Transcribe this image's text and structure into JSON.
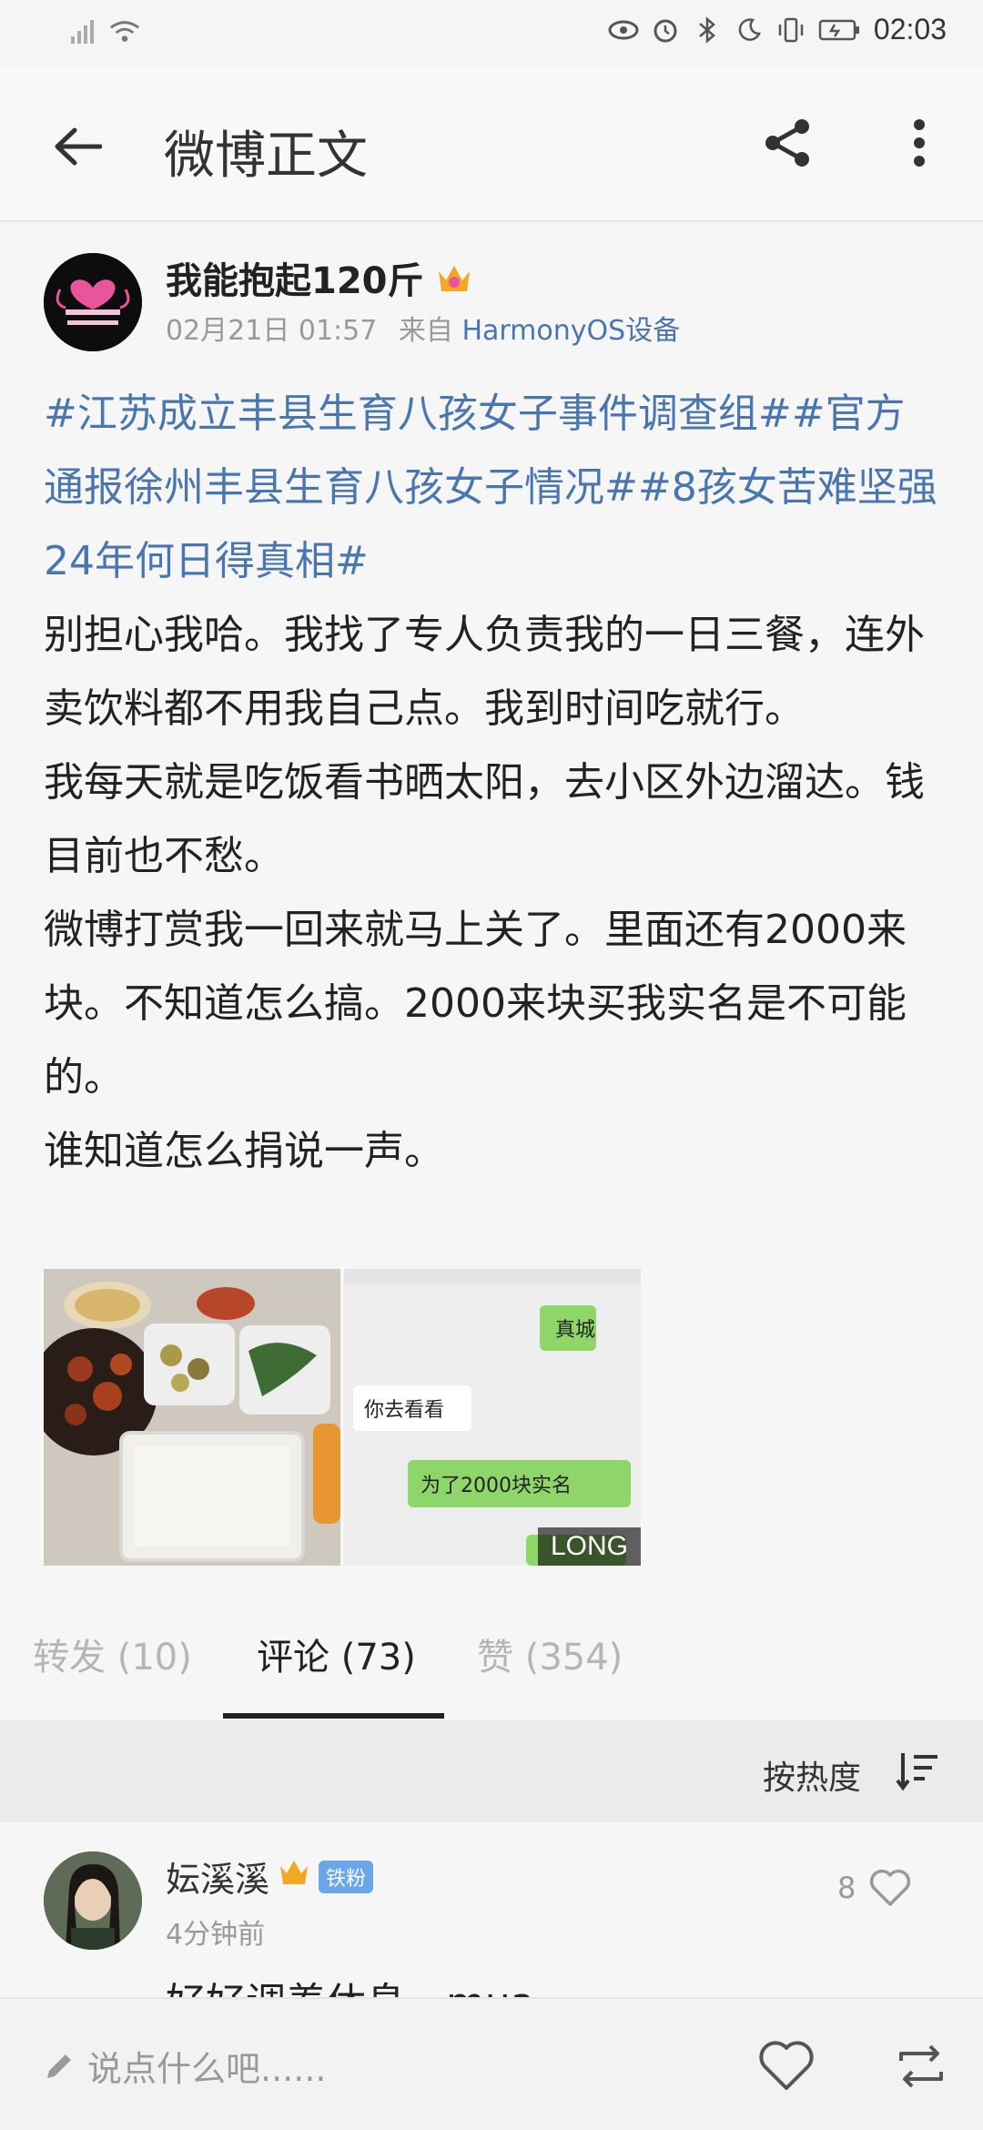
{
  "status_bar": {
    "time": "02:03"
  },
  "header": {
    "title": "微博正文"
  },
  "post": {
    "author": "我能抱起120斤",
    "timestamp": "02月21日 01:57",
    "source_prefix": "来自",
    "source": "HarmonyOS设备",
    "topics": "#江苏成立丰县生育八孩女子事件调查组##官方通报徐州丰县生育八孩女子情况##8孩女苦难坚强24年何日得真相#",
    "paragraphs": [
      "别担心我哈。我找了专人负责我的一日三餐，连外卖饮料都不用我自己点。我到时间吃就行。",
      "我每天就是吃饭看书晒太阳，去小区外边溜达。钱目前也不愁。",
      "微博打赏我一回来就马上关了。里面还有2000来块。不知道怎么搞。2000来块买我实名是不可能的。",
      "谁知道怎么捐说一声。"
    ],
    "photo2_badge": "LONG",
    "photo2_texts": [
      "真城",
      "你去看看",
      "为了2000块实名"
    ]
  },
  "tabs": [
    {
      "label": "转发 (10)"
    },
    {
      "label": "评论 (73)"
    },
    {
      "label": "赞 (354)"
    }
  ],
  "sort": {
    "label": "按热度"
  },
  "comment": {
    "name": "妘溪溪",
    "badge": "铁粉",
    "time": "4分钟前",
    "likes": "8",
    "text": "好好调养休息。mua"
  },
  "bottom": {
    "placeholder": "说点什么吧......"
  }
}
